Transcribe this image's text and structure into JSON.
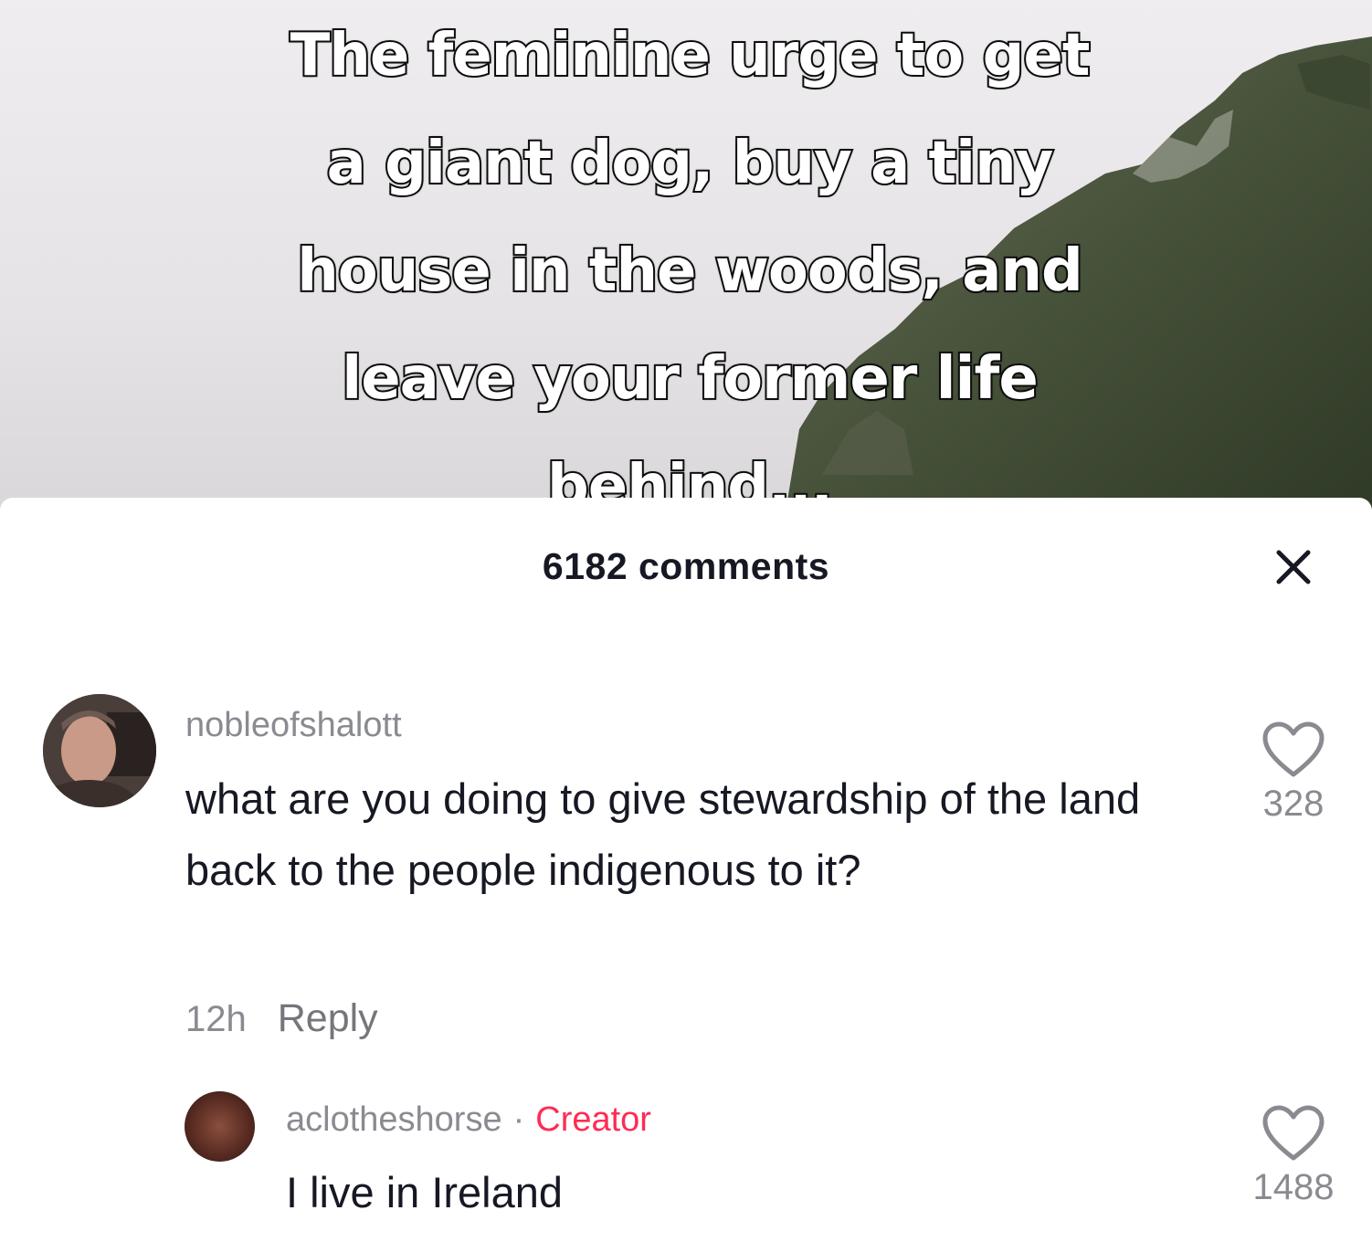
{
  "video": {
    "caption_lines": [
      "The feminine urge to get",
      "a giant dog, buy a tiny",
      "house in the woods, and",
      "leave your former life",
      "behind..."
    ]
  },
  "comments_sheet": {
    "title": "6182 comments",
    "close_icon": "close-icon",
    "comments": [
      {
        "username": "nobleofshalott",
        "text": "what are you doing to give stewardship of the land back to the people indigenous to it?",
        "time": "12h",
        "reply_label": "Reply",
        "likes": "328"
      },
      {
        "username": "aclotheshorse",
        "separator": "·",
        "badge": "Creator",
        "text": "I live in Ireland",
        "likes": "1488"
      }
    ]
  },
  "colors": {
    "accent_creator": "#fe2c55",
    "text_primary": "#161823",
    "text_secondary": "#8a8b91"
  }
}
